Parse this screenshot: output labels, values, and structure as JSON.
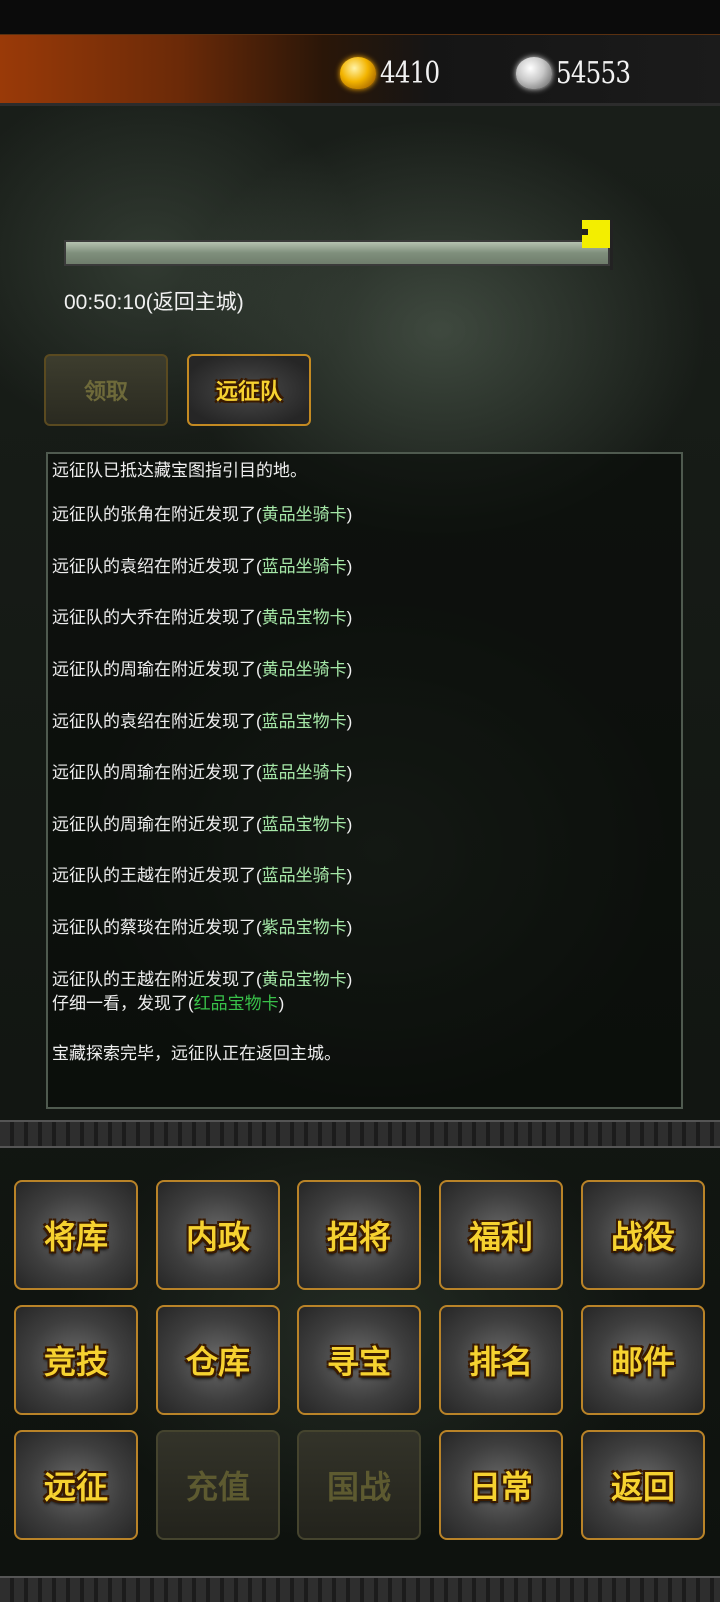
{
  "header": {
    "gold": "4410",
    "silver": "54553",
    "gold_icon": "gold-ingot-icon",
    "silver_icon": "silver-ingot-icon"
  },
  "progress": {
    "value": 1.0,
    "text": "00:50:10(返回主城)"
  },
  "actions": {
    "claim": "领取",
    "team": "远征队"
  },
  "log": [
    {
      "text": "远征队已抵达藏宝图指引目的地。"
    },
    {
      "text": "远征队的张角在附近发现了(",
      "item": "黄品坐骑卡",
      "end": ")"
    },
    {
      "text": "远征队的袁绍在附近发现了(",
      "item": "蓝品坐骑卡",
      "end": ")"
    },
    {
      "text": "远征队的大乔在附近发现了(",
      "item": "黄品宝物卡",
      "end": ")"
    },
    {
      "text": "远征队的周瑜在附近发现了(",
      "item": "黄品坐骑卡",
      "end": ")"
    },
    {
      "text": "远征队的袁绍在附近发现了(",
      "item": "蓝品宝物卡",
      "end": ")"
    },
    {
      "text": "远征队的周瑜在附近发现了(",
      "item": "蓝品坐骑卡",
      "end": ")"
    },
    {
      "text": "远征队的周瑜在附近发现了(",
      "item": "蓝品宝物卡",
      "end": ")"
    },
    {
      "text": "远征队的王越在附近发现了(",
      "item": "蓝品坐骑卡",
      "end": ")"
    },
    {
      "text": "远征队的蔡琰在附近发现了(",
      "item": "紫品宝物卡",
      "end": ")"
    },
    {
      "text": "远征队的王越在附近发现了(",
      "item": "黄品宝物卡",
      "end": ")"
    },
    {
      "text": "仔细一看，发现了(",
      "item": "红品宝物卡",
      "end": ")"
    },
    {
      "text": "宝藏探索完毕，远征队正在返回主城。"
    }
  ],
  "menu": [
    {
      "label": "将库",
      "enabled": true
    },
    {
      "label": "内政",
      "enabled": true
    },
    {
      "label": "招将",
      "enabled": true
    },
    {
      "label": "福利",
      "enabled": true
    },
    {
      "label": "战役",
      "enabled": true
    },
    {
      "label": "竞技",
      "enabled": true
    },
    {
      "label": "仓库",
      "enabled": true
    },
    {
      "label": "寻宝",
      "enabled": true
    },
    {
      "label": "排名",
      "enabled": true
    },
    {
      "label": "邮件",
      "enabled": true
    },
    {
      "label": "远征",
      "enabled": true
    },
    {
      "label": "充值",
      "enabled": false
    },
    {
      "label": "国战",
      "enabled": false
    },
    {
      "label": "日常",
      "enabled": true
    },
    {
      "label": "返回",
      "enabled": true
    }
  ],
  "colors": {
    "button_text": "#f6d230",
    "button_border": "#b98328",
    "item_text": "#a6e8a8",
    "red_item_text": "#39c24a",
    "progress_marker": "#f3ee00"
  }
}
